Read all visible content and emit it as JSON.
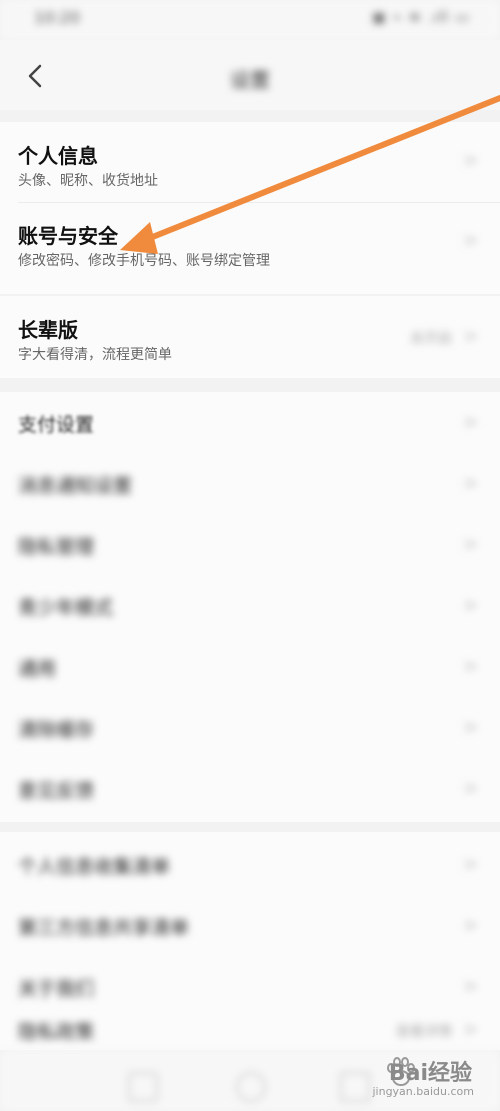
{
  "status_bar": {
    "time": "10:20",
    "icons": "▣ ⌁ ≋ .ıll ▭"
  },
  "nav": {
    "title": "设置",
    "back_icon": "chevron-left-icon"
  },
  "group1": {
    "items": [
      {
        "title": "个人信息",
        "subtitle": "头像、昵称、收货地址"
      },
      {
        "title": "账号与安全",
        "subtitle": "修改密码、修改手机号码、账号绑定管理"
      }
    ]
  },
  "group2": {
    "items": [
      {
        "title": "长辈版",
        "subtitle": "字大看得清，流程更简单",
        "value": "未开启"
      }
    ]
  },
  "group3": {
    "items": [
      {
        "title": "支付设置"
      },
      {
        "title": "消息通知设置"
      },
      {
        "title": "隐私管理"
      },
      {
        "title": "青少年模式"
      },
      {
        "title": "通用"
      },
      {
        "title": "清除缓存"
      },
      {
        "title": "意见反馈"
      }
    ]
  },
  "group4": {
    "items": [
      {
        "title": "个人信息收集清单"
      },
      {
        "title": "第三方信息共享清单"
      },
      {
        "title": "关于我们"
      },
      {
        "title": "隐私政策",
        "value": "查看详情"
      }
    ]
  },
  "annotation": {
    "color": "#f08a3c"
  },
  "watermark": {
    "text": "Bai经验",
    "sub": "jingyan.baidu.com"
  }
}
